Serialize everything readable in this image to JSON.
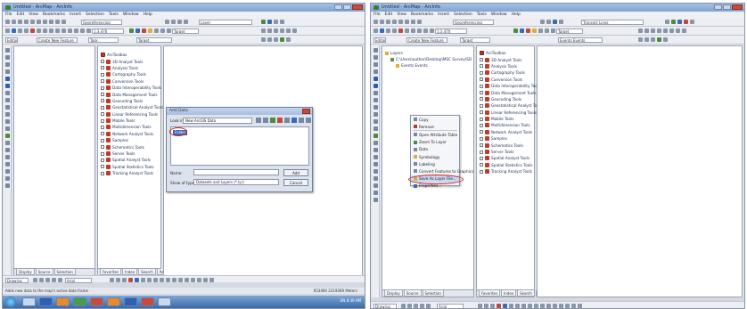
{
  "left": {
    "window_title": "Untitled - ArcMap - ArcInfo",
    "menus": [
      "File",
      "Edit",
      "View",
      "Bookmarks",
      "Insert",
      "Selection",
      "Tools",
      "Window",
      "Help"
    ],
    "combo_georef": "Georeferencing",
    "combo_scale": "1:3,470",
    "combo_editor": "Editor",
    "combo_create": "Create New Feature",
    "combo_task": "Task",
    "combo_layer": "Layer",
    "combo_target": "Target",
    "combo_spatial": "Spatial Analyst",
    "toolbox_items": [
      "ArcToolbox",
      "3D Analyst Tools",
      "Analysis Tools",
      "Cartography Tools",
      "Conversion Tools",
      "Data Interoperability Tools",
      "Data Management Tools",
      "Geocoding Tools",
      "Geostatistical Analyst Tools",
      "Linear Referencing Tools",
      "Mobile Tools",
      "Multidimension Tools",
      "Network Analyst Tools",
      "Samples",
      "Schematics Tools",
      "Server Tools",
      "Spatial Analyst Tools",
      "Spatial Statistics Tools",
      "Tracking Analyst Tools"
    ],
    "toc_tabs": [
      "Display",
      "Source",
      "Selection"
    ],
    "toolbox_tabs": [
      "Favorites",
      "Index",
      "Search",
      "Results"
    ],
    "draw_label": "Drawing",
    "font_combo": "Arial",
    "status_text": "Adds new data to the map's active data frame",
    "coords": "653460 2319369 Meters",
    "dialog": {
      "title": "Add Data",
      "look_in_label": "Look in:",
      "look_in_value": "New ArcGIS Data",
      "list_item": "Folder",
      "name_label": "Name:",
      "type_label": "Show of type:",
      "type_value": "Datasets and Layers (*.lyr)",
      "add_btn": "Add",
      "cancel_btn": "Cancel"
    }
  },
  "right": {
    "window_title": "Untitled - ArcMap - ArcInfo",
    "menus": [
      "File",
      "Edit",
      "View",
      "Bookmarks",
      "Insert",
      "Selection",
      "Tools",
      "Window",
      "Help"
    ],
    "combo_georef": "Georeferencing",
    "combo_transect": "Transect Lines",
    "combo_scale": "1:3,470",
    "combo_editor": "Editor",
    "combo_create": "Create New Feature",
    "combo_target": "Target",
    "combo_layer": "Layer",
    "combo_spatial": "Spatial Analyst",
    "combo_events": "Events Events",
    "tree": [
      "Layers",
      "C:\\Users\\author\\Desktop\\MSC Survey\\SD",
      "Events Events"
    ],
    "context_menu": [
      "Copy",
      "Remove",
      "Open Attribute Table",
      "Zoom To Layer",
      "Data",
      "Symbology",
      "Labeling",
      "Convert Features to Graphics",
      "Display Route Events",
      "Save As Layer File...",
      "Properties..."
    ],
    "toolbox_items": [
      "ArcToolbox",
      "3D Analyst Tools",
      "Analysis Tools",
      "Cartography Tools",
      "Conversion Tools",
      "Data Interoperability Tools",
      "Data Management Tools",
      "Geocoding Tools",
      "Geostatistical Analyst Tools",
      "Linear Referencing Tools",
      "Mobile Tools",
      "Multidimension Tools",
      "Network Analyst Tools",
      "Samples",
      "Schematics Tools",
      "Server Tools",
      "Spatial Analyst Tools",
      "Spatial Statistics Tools",
      "Tracking Analyst Tools"
    ],
    "toc_tabs": [
      "Display",
      "Source",
      "Selection"
    ],
    "toolbox_tabs": [
      "Favorites",
      "Index",
      "Search",
      "Results"
    ],
    "draw_label": "Drawing",
    "font_combo": "Arial"
  },
  "colors": {
    "title_grad": "#7ea3d6",
    "accent_red": "#d0201a",
    "select_blue": "#3a6ab8"
  },
  "taskbar": {
    "tray_text": "EN 8:30 AM"
  }
}
